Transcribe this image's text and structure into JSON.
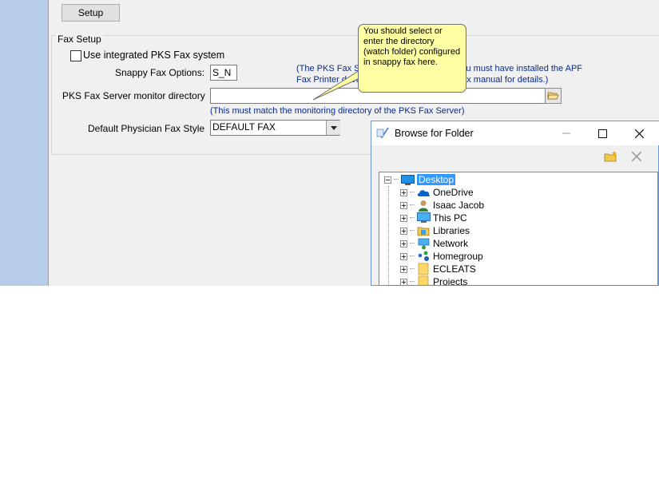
{
  "toolbar": {
    "setup_label": "Setup"
  },
  "fax_setup": {
    "group_title": "Fax Setup",
    "integrated_label": "Use integrated PKS Fax system",
    "integrated_checked": false,
    "snappy_label": "Snappy Fax Options:",
    "snappy_value": "S_N",
    "note_line1": "(The PKS Fax S",
    "note_line1b": "ested and you must have installed the APF",
    "note_line2": "Fax Printer drive",
    "note_line2b": "the fax manual for details.)",
    "monitor_label": "PKS Fax Server monitor directory",
    "monitor_value": "",
    "monitor_note": "(This must match the monitoring directory of the PKS Fax Server)",
    "style_label": "Default Physician Fax Style",
    "style_value": "DEFAULT FAX"
  },
  "tooltip": {
    "text": "You should select or enter the directory (watch folder) configured in snappy fax here."
  },
  "dialog": {
    "title": "Browse for Folder",
    "tree": [
      {
        "label": "Desktop",
        "icon": "desktop-icon",
        "selected": true
      },
      {
        "label": "OneDrive",
        "icon": "onedrive-icon"
      },
      {
        "label": "Isaac Jacob",
        "icon": "user-icon"
      },
      {
        "label": "This PC",
        "icon": "computer-icon"
      },
      {
        "label": "Libraries",
        "icon": "libraries-icon"
      },
      {
        "label": "Network",
        "icon": "network-icon"
      },
      {
        "label": "Homegroup",
        "icon": "homegroup-icon"
      },
      {
        "label": "ECLEATS",
        "icon": "folder-icon"
      },
      {
        "label": "Projects",
        "icon": "folder-icon"
      }
    ]
  },
  "colors": {
    "accent": "#3399ff",
    "note_text": "#0a2a8a",
    "tooltip_bg": "#ffffa4",
    "side_strip": "#b7cde9"
  }
}
